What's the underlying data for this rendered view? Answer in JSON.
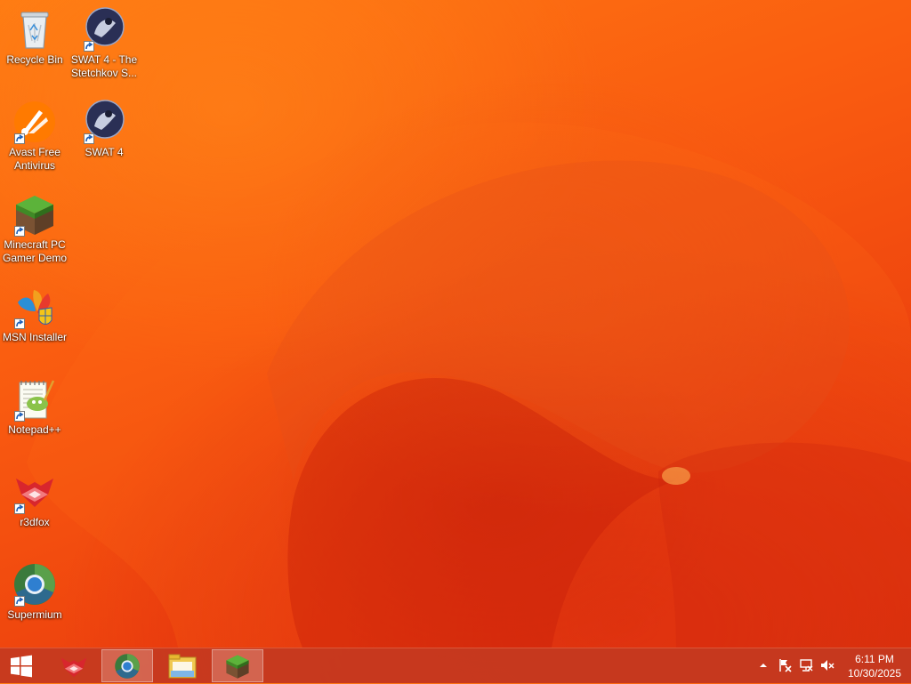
{
  "desktop": {
    "icons": [
      {
        "label": "Recycle Bin",
        "icon": "recycle-bin-icon"
      },
      {
        "label": "SWAT 4 - The Stetchkov S...",
        "icon": "swat4-icon",
        "shortcut": true
      },
      {
        "label": "Avast Free Antivirus",
        "icon": "avast-icon",
        "shortcut": true
      },
      {
        "label": "SWAT 4",
        "icon": "swat4-icon",
        "shortcut": true
      },
      {
        "label": "Minecraft PC Gamer Demo",
        "icon": "minecraft-icon",
        "shortcut": true
      },
      {
        "label": "MSN Installer",
        "icon": "msn-icon",
        "shortcut": true
      },
      {
        "label": "Notepad++",
        "icon": "notepadpp-icon",
        "shortcut": true
      },
      {
        "label": "r3dfox",
        "icon": "r3dfox-icon",
        "shortcut": true
      },
      {
        "label": "Supermium",
        "icon": "supermium-icon",
        "shortcut": true
      }
    ]
  },
  "taskbar": {
    "start": {
      "icon": "windows-logo-icon"
    },
    "pinned": [
      {
        "icon": "r3dfox-icon",
        "active": false
      },
      {
        "icon": "supermium-icon",
        "active": true
      },
      {
        "icon": "file-explorer-icon",
        "active": false
      },
      {
        "icon": "minecraft-icon",
        "active": true
      }
    ],
    "tray": {
      "icons": [
        "show-hidden-icons-arrow",
        "action-center-flag-icon",
        "network-icon",
        "volume-muted-icon"
      ],
      "time": "6:11 PM",
      "date": "10/30/2025"
    }
  },
  "colors": {
    "wallpaper_primary": "#f95a10",
    "wallpaper_dark": "#d92a0c",
    "taskbar": "#c43a20"
  }
}
